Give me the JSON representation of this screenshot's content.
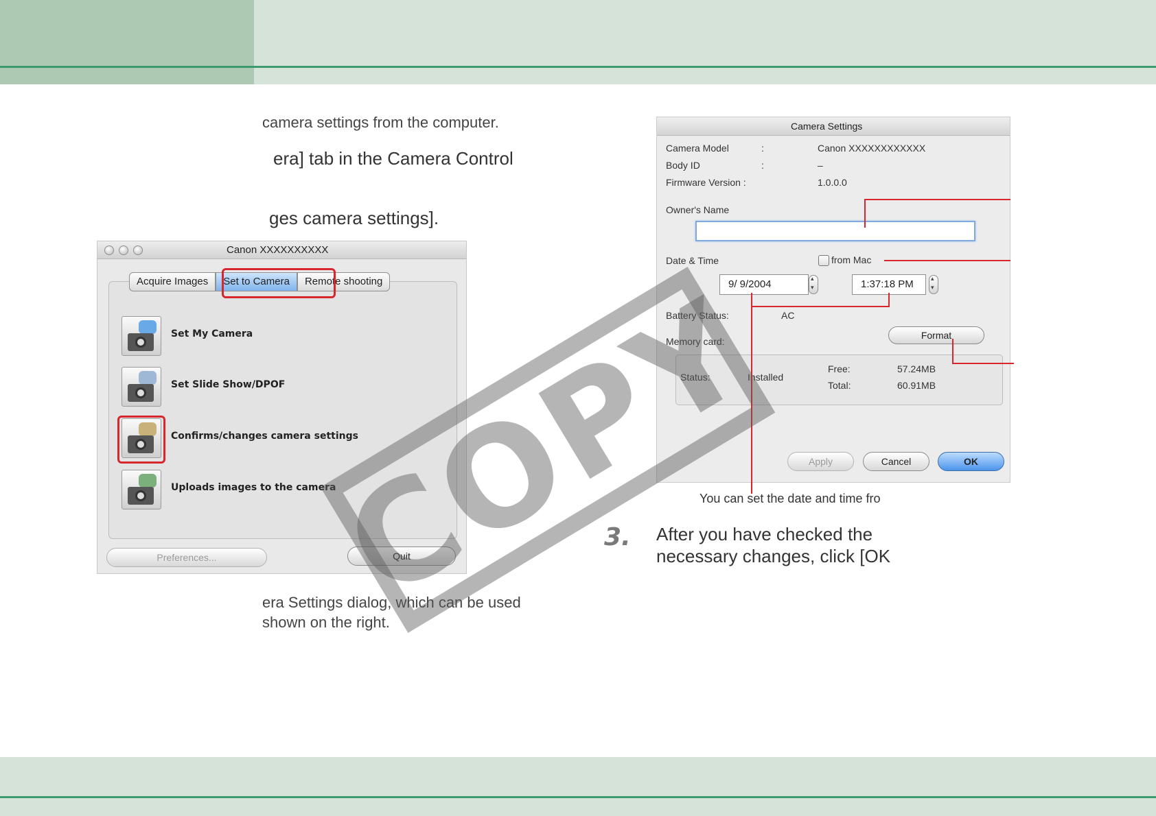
{
  "left_column": {
    "line1": "camera settings from the computer.",
    "line2": "era] tab in the Camera Control",
    "line3": "ges camera settings].",
    "line4": "era Settings dialog, which can be used",
    "line5": "shown on the right."
  },
  "canon_window": {
    "title": "Canon XXXXXXXXXX",
    "tabs": [
      "Acquire Images",
      "Set to Camera",
      "Remote shooting"
    ],
    "items": [
      {
        "label": "Set My Camera"
      },
      {
        "label": "Set Slide Show/DPOF"
      },
      {
        "label": "Confirms/changes camera settings"
      },
      {
        "label": "Uploads images to the camera"
      }
    ],
    "preferences_label": "Preferences...",
    "quit_label": "Quit"
  },
  "camera_settings": {
    "title": "Camera Settings",
    "camera_model_label": "Camera Model",
    "camera_model_sep": ":",
    "camera_model_value": "Canon XXXXXXXXXXXX",
    "body_id_label": "Body ID",
    "body_id_sep": ":",
    "body_id_value": "–",
    "firmware_label": "Firmware Version :",
    "firmware_value": "1.0.0.0",
    "owner_name_label": "Owner's Name",
    "owner_name_value": "",
    "date_time_label": "Date & Time",
    "from_mac_label": "from Mac",
    "date_value": "9/  9/2004",
    "time_value": "1:37:18 PM",
    "battery_label": "Battery Status:",
    "battery_value": "AC",
    "memory_card_label": "Memory card:",
    "format_label": "Format",
    "status_label": "Status:",
    "status_value": "Installed",
    "free_label": "Free:",
    "free_value": "57.24MB",
    "total_label": "Total:",
    "total_value": "60.91MB",
    "apply_label": "Apply",
    "cancel_label": "Cancel",
    "ok_label": "OK"
  },
  "callout_text": "You can set the date and time fro",
  "step": {
    "number": "3.",
    "line1": "After you have checked the",
    "line2": "necessary changes, click [OK"
  },
  "watermark": "COPY",
  "colors": {
    "header_dark": "#aec9b3",
    "header_light": "#d5e3d8",
    "accent_line": "#3c9a6e",
    "highlight_red": "#d8262d"
  }
}
